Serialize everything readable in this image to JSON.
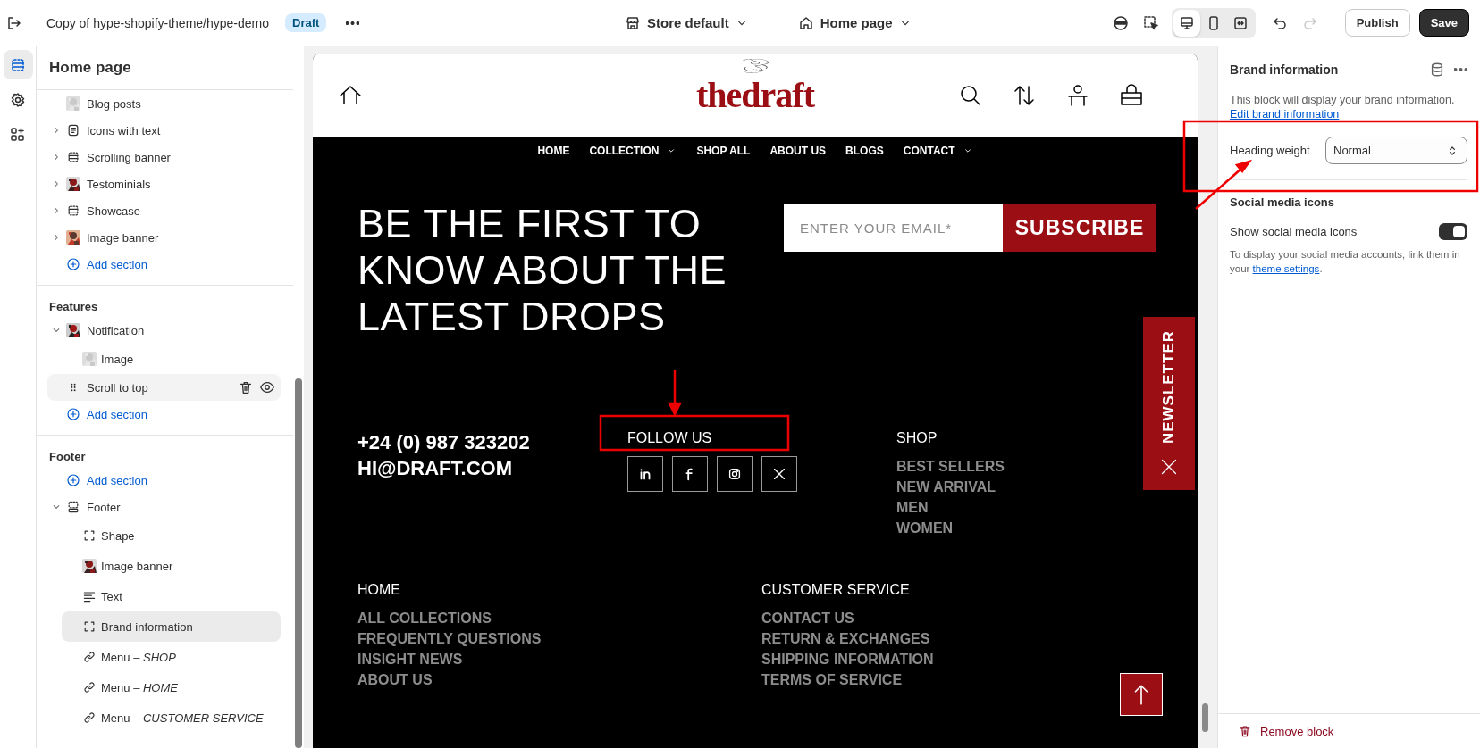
{
  "top_bar": {
    "title": "Copy of hype-shopify-theme/hype-demo",
    "badge": "Draft",
    "store": "Store default",
    "page": "Home page",
    "view_modes": [
      {
        "kind": "desktop",
        "selected": true
      },
      {
        "kind": "mobile",
        "selected": false
      },
      {
        "kind": "fullwidth",
        "selected": false
      }
    ],
    "history": [
      {
        "kind": "undo",
        "disabled": false
      },
      {
        "kind": "redo",
        "disabled": true
      }
    ],
    "buttons": [
      {
        "label": "Publish",
        "kind": "secondary"
      },
      {
        "label": "Save",
        "kind": "primary"
      }
    ]
  },
  "rail": [
    {
      "kind": "sections",
      "selected": true
    },
    {
      "kind": "settings",
      "selected": false
    },
    {
      "kind": "apps",
      "selected": false
    }
  ],
  "sidebar": {
    "title": "Home page",
    "groups": [
      {
        "items": [
          {
            "label": "Blog posts",
            "kind": "thumb",
            "selected": false
          },
          {
            "label": "Icons with text",
            "kind": "list",
            "expanded": false,
            "selected": false
          },
          {
            "label": "Scrolling banner",
            "kind": "layout",
            "expanded": false,
            "selected": false
          },
          {
            "label": "Testominials",
            "kind": "thumb",
            "expanded": false,
            "selected": false
          },
          {
            "label": "Showcase",
            "kind": "layout",
            "expanded": false,
            "selected": false
          },
          {
            "label": "Image banner",
            "kind": "thumb",
            "expanded": false,
            "selected": false
          },
          {
            "label": "Add section",
            "kind": "add"
          }
        ]
      },
      {
        "title": "Features",
        "items": [
          {
            "label": "Notification",
            "kind": "thumb",
            "expanded": true,
            "selected": false,
            "children": [
              {
                "label": "Image",
                "kind": "thumb",
                "selected": false
              }
            ]
          },
          {
            "label": "Scroll to top",
            "kind": "drag",
            "selected": false
          },
          {
            "label": "Add section",
            "kind": "add"
          }
        ]
      },
      {
        "title": "Footer",
        "items": [
          {
            "label": "Add section",
            "kind": "add"
          },
          {
            "label": "Footer",
            "kind": "footer",
            "expanded": true,
            "selected": false,
            "children": [
              {
                "label": "Shape",
                "kind": "frame",
                "selected": false
              },
              {
                "label": "Image banner",
                "kind": "thumb",
                "selected": false
              },
              {
                "label": "Text",
                "kind": "lines",
                "selected": false
              },
              {
                "label": "Brand information",
                "kind": "frame",
                "selected": true
              },
              {
                "label": "Menu – *SHOP*",
                "kind": "link",
                "selected": false
              },
              {
                "label": "Menu – *HOME*",
                "kind": "link",
                "selected": false
              },
              {
                "label": "Menu – *CUSTOMER SERVICE*",
                "kind": "link",
                "selected": false
              }
            ]
          }
        ]
      }
    ]
  },
  "preview": {
    "logo": "thedraft",
    "nav": [
      {
        "label": "HOME",
        "dropdown": false
      },
      {
        "label": "COLLECTION",
        "dropdown": true
      },
      {
        "label": "SHOP ALL",
        "dropdown": false
      },
      {
        "label": "ABOUT US",
        "dropdown": false
      },
      {
        "label": "BLOGS",
        "dropdown": false
      },
      {
        "label": "CONTACT",
        "dropdown": true
      }
    ],
    "newsletter": {
      "heading": "BE THE FIRST TO KNOW ABOUT THE LATEST DROPS",
      "placeholder": "ENTER YOUR EMAIL*",
      "button": "SUBSCRIBE",
      "tab": "NEWSLETTER"
    },
    "contact": [
      "+24 (0) 987 323202",
      "HI@DRAFT.COM"
    ],
    "follow": {
      "title": "FOLLOW US",
      "socials": [
        {
          "kind": "linkedin"
        },
        {
          "kind": "facebook"
        },
        {
          "kind": "instagram"
        },
        {
          "kind": "x"
        }
      ]
    },
    "menus": [
      {
        "title": "SHOP",
        "links": [
          "BEST SELLERS",
          "NEW ARRIVAL",
          "MEN",
          "WOMEN"
        ]
      },
      {
        "title": "HOME",
        "links": [
          "ALL COLLECTIONS",
          "FREQUENTLY QUESTIONS",
          "INSIGHT NEWS",
          "ABOUT US"
        ]
      },
      {
        "title": "CUSTOMER SERVICE",
        "links": [
          "CONTACT US",
          "RETURN & EXCHANGES",
          "SHIPPING INFORMATION",
          "TERMS OF SERVICE"
        ]
      }
    ]
  },
  "panel": {
    "title": "Brand information",
    "description": "This block will display your brand information.",
    "link": "Edit brand information",
    "field": {
      "label": "Heading weight",
      "value": "Normal"
    },
    "section": "Social media icons",
    "toggle": {
      "label": "Show social media icons",
      "on": true
    },
    "help": {
      "text": "To display your social media accounts, link them in your",
      "link": "theme settings",
      "end": "."
    },
    "remove": "Remove block"
  }
}
